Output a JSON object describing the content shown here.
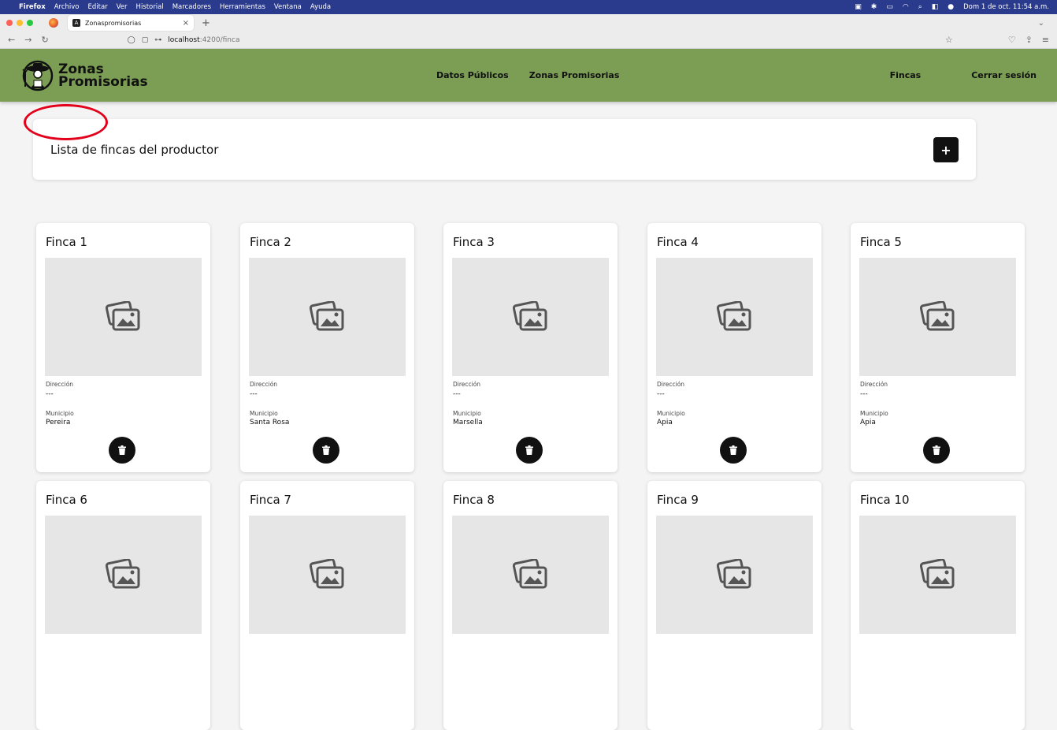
{
  "menubar": {
    "app": "Firefox",
    "items": [
      "Archivo",
      "Editar",
      "Ver",
      "Historial",
      "Marcadores",
      "Herramientas",
      "Ventana",
      "Ayuda"
    ],
    "clock": "Dom 1 de oct.  11:54 a.m."
  },
  "browser": {
    "tab_title": "Zonaspromisorias",
    "url_host": "localhost",
    "url_path": ":4200/finca"
  },
  "app": {
    "logo_line1": "Zonas",
    "logo_line2": "Promisorias",
    "nav_center": [
      "Datos Públicos",
      "Zonas Promisorias"
    ],
    "nav_right": [
      "Fincas",
      "Cerrar sesión"
    ]
  },
  "header": {
    "title": "Lista de fincas del productor",
    "add_label": "+"
  },
  "cards": [
    {
      "title": "Finca 1",
      "dir_label": "Dirección",
      "dir": "---",
      "mun_label": "Municipio",
      "mun": "Pereira"
    },
    {
      "title": "Finca 2",
      "dir_label": "Dirección",
      "dir": "---",
      "mun_label": "Municipio",
      "mun": "Santa Rosa"
    },
    {
      "title": "Finca 3",
      "dir_label": "Dirección",
      "dir": "---",
      "mun_label": "Municipio",
      "mun": "Marsella"
    },
    {
      "title": "Finca 4",
      "dir_label": "Dirección",
      "dir": "---",
      "mun_label": "Municipio",
      "mun": "Apia"
    },
    {
      "title": "Finca 5",
      "dir_label": "Dirección",
      "dir": "---",
      "mun_label": "Municipio",
      "mun": "Apia"
    },
    {
      "title": "Finca 6"
    },
    {
      "title": "Finca 7"
    },
    {
      "title": "Finca 8"
    },
    {
      "title": "Finca 9"
    },
    {
      "title": "Finca 10"
    }
  ],
  "colors": {
    "navbar": "#7b9e54",
    "annotation": "#e3001b",
    "button": "#111111"
  }
}
